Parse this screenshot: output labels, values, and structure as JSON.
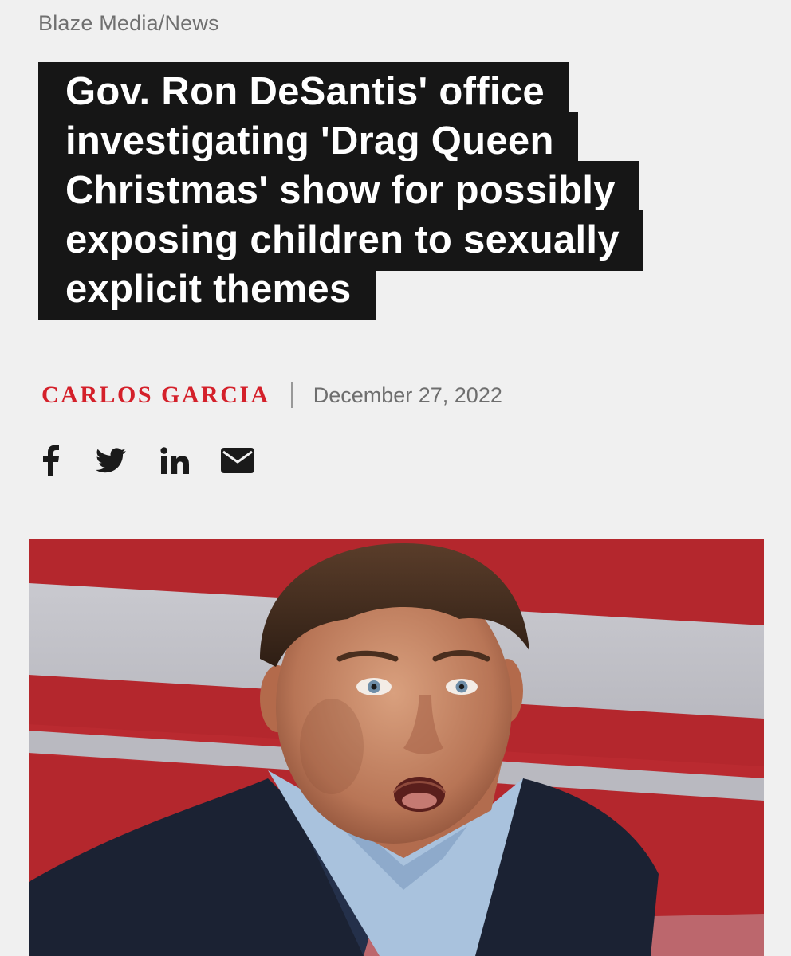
{
  "breadcrumb": "Blaze Media/News",
  "headline": "Gov. Ron DeSantis' office investigating 'Drag Queen Christmas' show for possibly exposing children to sexually explicit themes",
  "byline": {
    "author": "CARLOS GARCIA",
    "separator": "|",
    "date": "December 27, 2022"
  },
  "share": [
    {
      "name": "facebook",
      "icon": "facebook-icon"
    },
    {
      "name": "twitter",
      "icon": "twitter-icon"
    },
    {
      "name": "linkedin",
      "icon": "linkedin-icon"
    },
    {
      "name": "email",
      "icon": "email-icon"
    }
  ],
  "hero_image": {
    "icon": "photo-man-in-suit-red-white-stripes"
  },
  "colors": {
    "background": "#f0f0f0",
    "headline_bg": "#161616",
    "headline_text": "#ffffff",
    "author": "#d4202a",
    "meta_text": "#6e6e6e"
  }
}
